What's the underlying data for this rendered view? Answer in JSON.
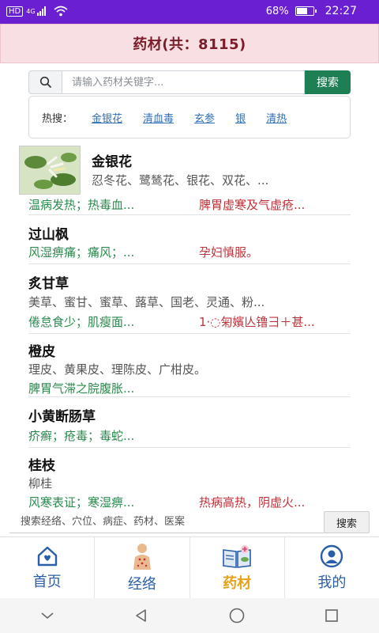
{
  "status_bar": {
    "network": "HD",
    "signal_label": "4G",
    "battery": "68%",
    "battery_level": 0.68,
    "time": "22:27"
  },
  "header": {
    "title": "药材(共：8115)"
  },
  "search": {
    "placeholder": "请输入药材关键字...",
    "button": "搜索"
  },
  "hot": {
    "label": "热搜：",
    "links": [
      "金银花",
      "清血毒",
      "玄参",
      "银",
      "清热"
    ]
  },
  "herbs": [
    {
      "name": "金银花",
      "alias": "忍冬花、鹭鸶花、银花、双花、...",
      "effect": "温病发热；热毒血...",
      "caution": "脾胃虚寒及气虚疮..."
    },
    {
      "name": "过山枫",
      "effect": "风湿痹痛；痛风；...",
      "caution": "孕妇慎服。"
    },
    {
      "name": "炙甘草",
      "alias": "美草、蜜甘、蜜草、蕗草、国老、灵通、粉...",
      "effect": "倦怠食少；肌瘦面...",
      "caution": "1·◌匊嬪亾镥彐＋甚..."
    },
    {
      "name": "橙皮",
      "alias": "理皮、黄果皮、理陈皮、广柑皮。",
      "effect": "脾胃气滞之脘腹胀..."
    },
    {
      "name": "小黄断肠草",
      "effect": "疥癣；疮毒；毒蛇..."
    },
    {
      "name": "桂枝",
      "alias": "柳桂",
      "effect": "风寒表证；寒湿痹...",
      "caution": "热病高热，阴虚火..."
    }
  ],
  "bottom_search": {
    "placeholder": "搜索经络、穴位、病症、药材、医案",
    "button": "搜索"
  },
  "tabs": [
    {
      "label": "首页",
      "icon": "home-icon"
    },
    {
      "label": "经络",
      "icon": "meridian-body-icon"
    },
    {
      "label": "药材",
      "icon": "herb-book-icon",
      "active": true
    },
    {
      "label": "我的",
      "icon": "user-icon"
    }
  ],
  "colors": {
    "status_bar": "#6a1fd0",
    "header_bg": "#f8dfe3",
    "header_text": "#7a1d2a",
    "search_button": "#1e7e54",
    "effect_green": "#2b8a4e",
    "caution_red": "#c0323a",
    "tab_blue": "#2a5ea8",
    "tab_active": "#e8a21a"
  }
}
